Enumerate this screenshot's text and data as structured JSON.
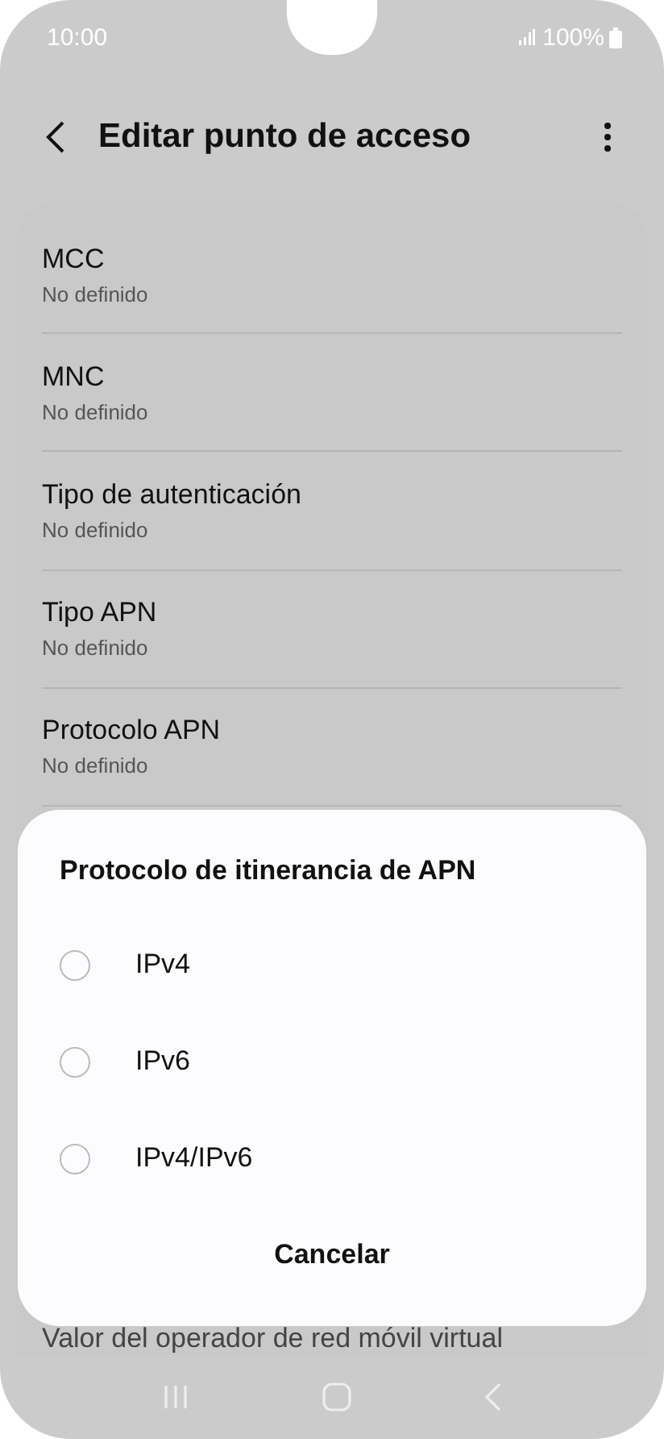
{
  "status_bar": {
    "time": "10:00",
    "battery": "100%"
  },
  "header": {
    "title": "Editar punto de acceso"
  },
  "settings": [
    {
      "title": "MCC",
      "value": "No definido"
    },
    {
      "title": "MNC",
      "value": "No definido"
    },
    {
      "title": "Tipo de autenticación",
      "value": "No definido"
    },
    {
      "title": "Tipo APN",
      "value": "No definido"
    },
    {
      "title": "Protocolo APN",
      "value": "No definido"
    }
  ],
  "peeking_setting": {
    "title": "Valor del operador de red móvil virtual"
  },
  "dialog": {
    "title": "Protocolo de itinerancia de APN",
    "options": [
      {
        "label": "IPv4",
        "selected": false
      },
      {
        "label": "IPv6",
        "selected": false
      },
      {
        "label": "IPv4/IPv6",
        "selected": false
      }
    ],
    "cancel": "Cancelar"
  }
}
